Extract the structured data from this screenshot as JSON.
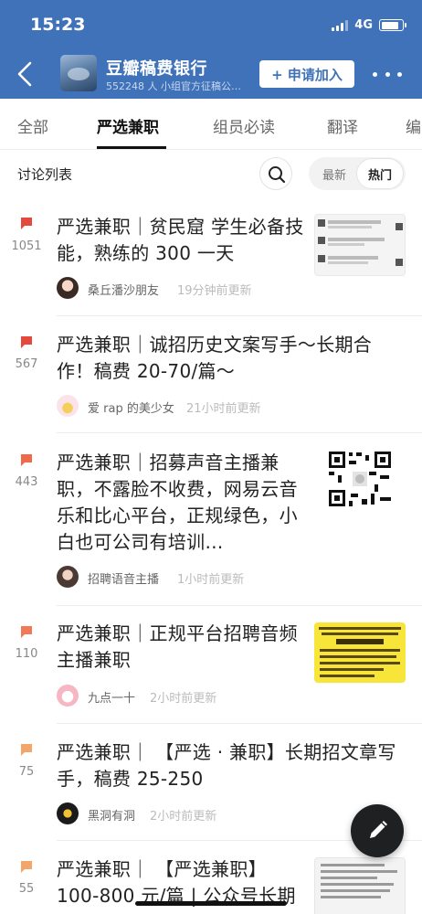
{
  "status_bar": {
    "time": "15:23",
    "network": "4G",
    "battery_level": 0.85
  },
  "header": {
    "title": "豆瓣稿费银行",
    "subtitle": "552248 人 小组官方征稿公…",
    "join_label": "+ 申请加入",
    "icons": {
      "back": "chevron-left-icon",
      "more": "more-dots-icon"
    }
  },
  "tabs": [
    {
      "label": "全部",
      "active": false
    },
    {
      "label": "严选兼职",
      "active": true
    },
    {
      "label": "组员必读",
      "active": false
    },
    {
      "label": "翻译",
      "active": false
    },
    {
      "label": "编",
      "active": false
    }
  ],
  "list_header": {
    "title": "讨论列表",
    "sort_latest": "最新",
    "sort_hot": "热门",
    "sort_selected": "热门"
  },
  "posts": [
    {
      "count": "1051",
      "title": "严选兼职｜贫民窟 学生必备技能，熟练的 300 一天",
      "author": "桑丘潘沙朋友",
      "time": "19分钟前更新",
      "flag_color": "#e5483d",
      "thumbnail": "chat-screenshot"
    },
    {
      "count": "567",
      "title": "严选兼职｜诚招历史文案写手～长期合作！稿费 20-70/篇～",
      "author": "爱 rap 的美少女",
      "time": "21小时前更新",
      "flag_color": "#e5483d",
      "thumbnail": ""
    },
    {
      "count": "443",
      "title": "严选兼职｜招募声音主播兼职，不露脸不收费，网易云音乐和比心平台，正规绿色，小白也可公司有培训…",
      "author": "招聘语音主播",
      "time": "1小时前更新",
      "flag_color": "#ef6a4a",
      "thumbnail": "qr-code"
    },
    {
      "count": "110",
      "title": "严选兼职｜正规平台招聘音频主播兼职",
      "author": "九点一十",
      "time": "2小时前更新",
      "flag_color": "#f07a57",
      "thumbnail": "yellow-poster"
    },
    {
      "count": "75",
      "title": "严选兼职｜ 【严选 · 兼职】长期招文章写手，稿费 25-250",
      "author": "黑洞有洞",
      "time": "2小时前更新",
      "flag_color": "#f3a56a",
      "thumbnail": ""
    },
    {
      "count": "55",
      "title": "严选兼职｜ 【严选兼职】100-800 元/篇 | 公众号长期",
      "author": "",
      "time": "",
      "flag_color": "#f3a56a",
      "thumbnail": "text-document"
    }
  ],
  "fab": {
    "icon": "pencil-icon"
  }
}
